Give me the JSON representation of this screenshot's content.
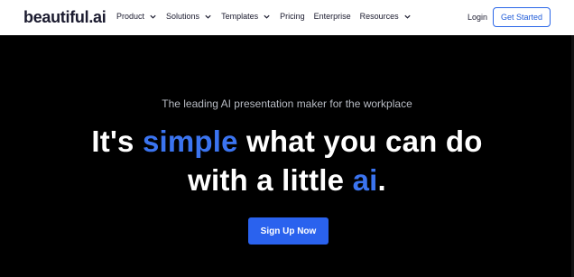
{
  "nav": {
    "logo_text": "beautiful",
    "logo_dot": ".",
    "logo_ai": "ai",
    "items": [
      {
        "label": "Product",
        "has_dropdown": true
      },
      {
        "label": "Solutions",
        "has_dropdown": true
      },
      {
        "label": "Templates",
        "has_dropdown": true
      },
      {
        "label": "Pricing",
        "has_dropdown": false
      },
      {
        "label": "Enterprise",
        "has_dropdown": false
      },
      {
        "label": "Resources",
        "has_dropdown": true
      }
    ],
    "login_label": "Login",
    "cta_label": "Get Started"
  },
  "hero": {
    "tagline": "The leading AI presentation maker for the workplace",
    "headline_part1": "It's ",
    "headline_accent1": "simple",
    "headline_part2": " what you can do",
    "headline_part3": "with a little ",
    "headline_accent2": "ai",
    "headline_part4": ".",
    "signup_label": "Sign Up Now"
  },
  "colors": {
    "accent": "#3b74f0",
    "button": "#2a62ee",
    "background": "#000000"
  }
}
